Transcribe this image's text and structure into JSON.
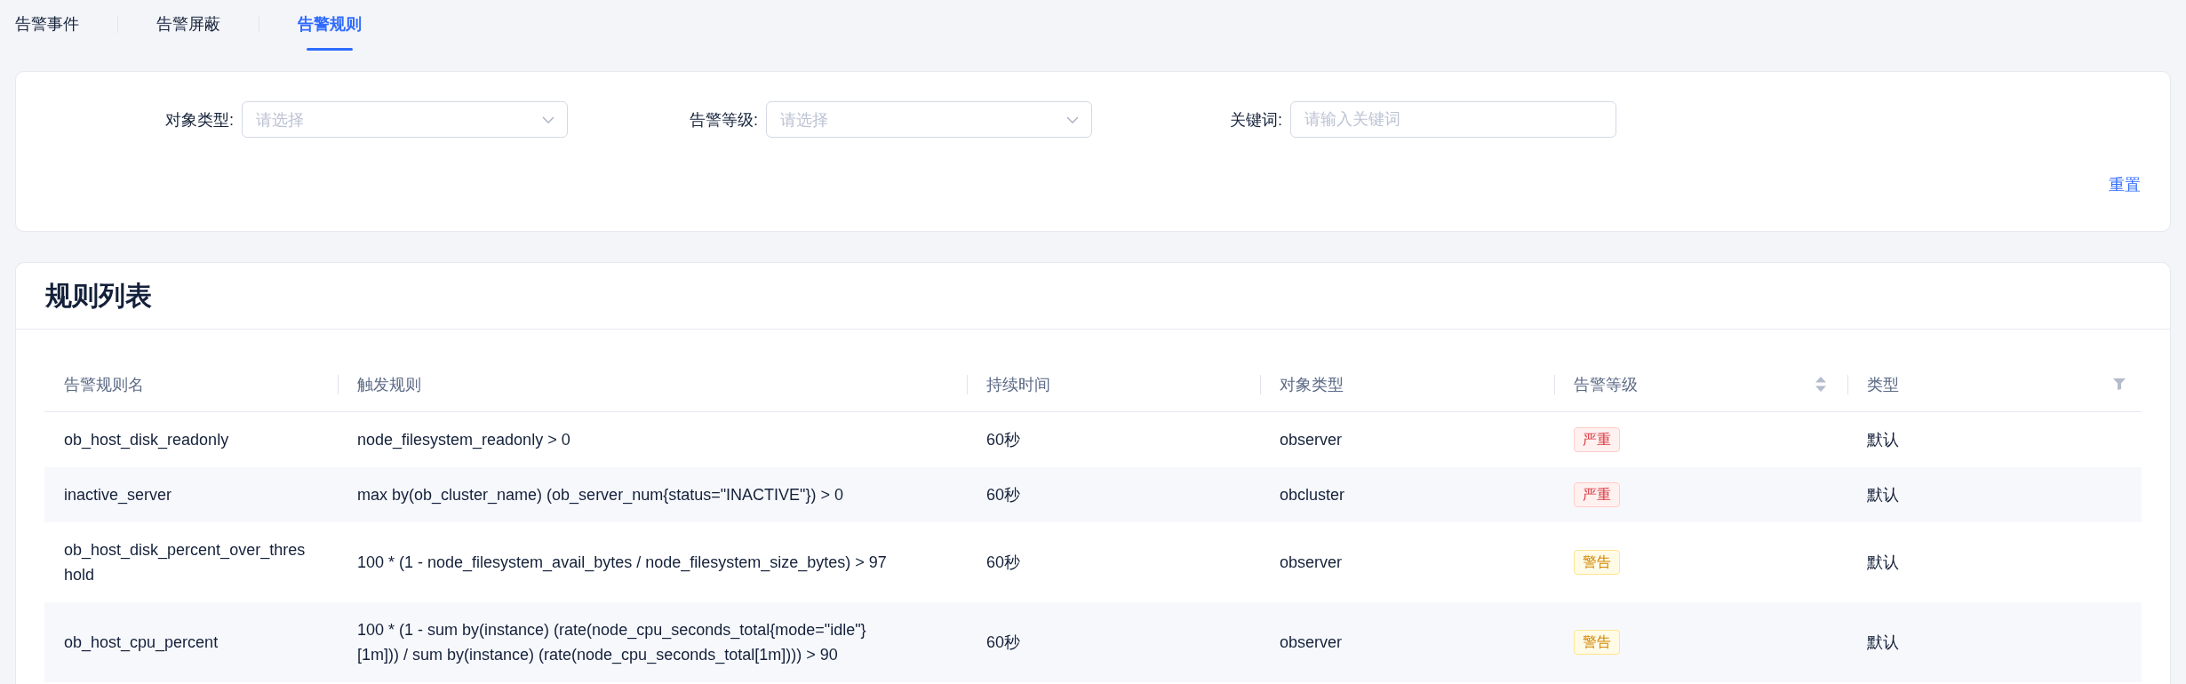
{
  "tabs": [
    {
      "label": "告警事件",
      "selected": false
    },
    {
      "label": "告警屏蔽",
      "selected": false
    },
    {
      "label": "告警规则",
      "selected": true
    }
  ],
  "filters": {
    "fields": [
      {
        "kind": "select",
        "label": "对象类型:",
        "placeholder": "请选择"
      },
      {
        "kind": "select",
        "label": "告警等级:",
        "placeholder": "请选择"
      },
      {
        "kind": "input",
        "label": "关键词:",
        "placeholder": "请输入关键词"
      }
    ],
    "reset_button": "重置"
  },
  "rules_table": {
    "title": "规则列表",
    "columns": [
      {
        "label": "告警规则名",
        "sortable": false,
        "filterable": false
      },
      {
        "label": "触发规则",
        "sortable": false,
        "filterable": false
      },
      {
        "label": "持续时间",
        "sortable": false,
        "filterable": false
      },
      {
        "label": "对象类型",
        "sortable": false,
        "filterable": false
      },
      {
        "label": "告警等级",
        "sortable": true,
        "filterable": false
      },
      {
        "label": "类型",
        "sortable": false,
        "filterable": true
      }
    ],
    "rows": [
      {
        "name": "ob_host_disk_readonly",
        "rule": "node_filesystem_readonly > 0",
        "duration": "60秒",
        "object_type": "observer",
        "level": {
          "label": "严重",
          "kind": "critical"
        },
        "type": "默认"
      },
      {
        "name": "inactive_server",
        "rule": "max by(ob_cluster_name) (ob_server_num{status=\"INACTIVE\"}) > 0",
        "duration": "60秒",
        "object_type": "obcluster",
        "level": {
          "label": "严重",
          "kind": "critical"
        },
        "type": "默认"
      },
      {
        "name": "ob_host_disk_percent_over_threshold",
        "rule": "100 * (1 - node_filesystem_avail_bytes / node_filesystem_size_bytes) > 97",
        "duration": "60秒",
        "object_type": "observer",
        "level": {
          "label": "警告",
          "kind": "warning"
        },
        "type": "默认"
      },
      {
        "name": "ob_host_cpu_percent",
        "rule": "100 * (1 - sum by(instance) (rate(node_cpu_seconds_total{mode=\"idle\"}[1m])) / sum by(instance) (rate(node_cpu_seconds_total[1m]))) > 90",
        "duration": "60秒",
        "object_type": "observer",
        "level": {
          "label": "警告",
          "kind": "warning"
        },
        "type": "默认"
      }
    ]
  }
}
